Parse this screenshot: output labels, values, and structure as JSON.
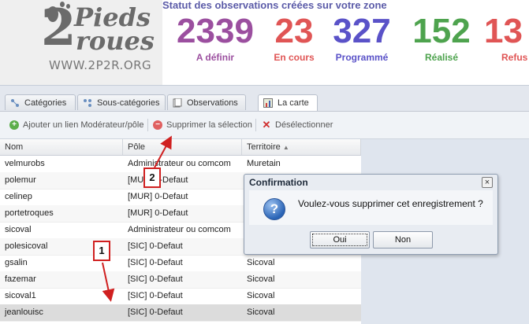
{
  "header": {
    "logo": {
      "big_digit": "2",
      "word1": "Pieds",
      "word2": "roues",
      "url": "WWW.2P2R.ORG"
    },
    "stats_title": "Statut des observations créées sur votre zone",
    "stats": [
      {
        "value": "2339",
        "label": "A définir",
        "color": "#9b4f9f"
      },
      {
        "value": "23",
        "label": "En cours",
        "color": "#e05555"
      },
      {
        "value": "327",
        "label": "Programmé",
        "color": "#5a52c8"
      },
      {
        "value": "152",
        "label": "Réalisé",
        "color": "#4ea34e"
      },
      {
        "value": "13",
        "label": "Refus",
        "color": "#e05555"
      }
    ]
  },
  "tabs": [
    {
      "label": "Catégories",
      "icon": "categories-icon",
      "active": false
    },
    {
      "label": "Sous-catégories",
      "icon": "subcategories-icon",
      "active": false
    },
    {
      "label": "Observations",
      "icon": "observations-icon",
      "active": false
    },
    {
      "label": "La carte",
      "icon": "map-icon",
      "active": true
    }
  ],
  "toolbar": {
    "add_label": "Ajouter un lien Modérateur/pôle",
    "delete_label": "Supprimer la sélection",
    "deselect_label": "Désélectionner"
  },
  "grid": {
    "columns": [
      "Nom",
      "Pôle",
      "Territoire"
    ],
    "sort_indicator": "▲",
    "rows": [
      [
        "velmurobs",
        "Administrateur ou comcom",
        "Muretain"
      ],
      [
        "polemur",
        "[MUR] 0-Defaut",
        ""
      ],
      [
        "celinep",
        "[MUR] 0-Defaut",
        ""
      ],
      [
        "portetroques",
        "[MUR] 0-Defaut",
        ""
      ],
      [
        "sicoval",
        "Administrateur ou comcom",
        ""
      ],
      [
        "polesicoval",
        "[SIC] 0-Defaut",
        ""
      ],
      [
        "gsalin",
        "[SIC] 0-Defaut",
        "Sicoval"
      ],
      [
        "fazemar",
        "[SIC] 0-Defaut",
        "Sicoval"
      ],
      [
        "sicoval1",
        "[SIC] 0-Defaut",
        "Sicoval"
      ],
      [
        "jeanlouisc",
        "[SIC] 0-Defaut",
        "Sicoval"
      ]
    ],
    "selected_row": 9
  },
  "dialog": {
    "title": "Confirmation",
    "close": "×",
    "question_icon": "?",
    "message": "Voulez-vous supprimer cet enregistrement ?",
    "ok_label": "Oui",
    "cancel_label": "Non"
  },
  "callouts": [
    "2",
    "1"
  ],
  "colors": {
    "callout": "#d02020",
    "stats_title": "#5b5ba8"
  }
}
